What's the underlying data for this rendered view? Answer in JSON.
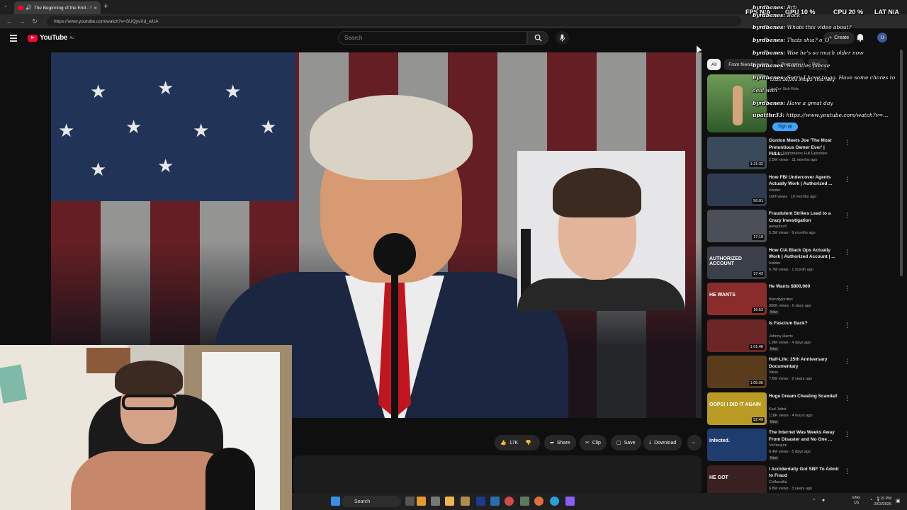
{
  "browser": {
    "tab_title": "The Beginning of the End - Yo",
    "url": "https://www.youtube.com/watch?v=SUQyvXd_wUA"
  },
  "youtube": {
    "logo_text": "YouTube",
    "logo_region": "AU",
    "search_placeholder": "Search",
    "create_label": "Create",
    "avatar_letter": "U"
  },
  "actions": {
    "likes": "17K",
    "share": "Share",
    "clip": "Clip",
    "save": "Save",
    "download": "Download"
  },
  "chips": [
    "All",
    "From friendlyjordies",
    "Podcasts",
    "Poli..."
  ],
  "ad": {
    "title": "Walk 10,000 Steps This May",
    "sub": "Up For Sick Kids",
    "cta": "Sign up"
  },
  "recommendations": [
    {
      "title": "Gordon Meets Joe 'The Most Pretentious Owner Ever' | FULL...",
      "channel": "Kitchen Nightmares Full Episodes",
      "meta": "2.5M views · 11 months ago",
      "duration": "1:21:32",
      "new": "",
      "color": "#3b4a5a"
    },
    {
      "title": "How FBI Undercover Agents Actually Work | Authorized ...",
      "channel": "Insider",
      "meta": "16M views · 10 months ago",
      "duration": "56:01",
      "new": "",
      "color": "#2e3b50"
    },
    {
      "title": "Fraudulent Strikes Lead to a Crazy Investigation",
      "channel": "penguinz0",
      "meta": "5.3M views · 9 months ago",
      "duration": "17:19",
      "new": "",
      "color": "#4b4f57"
    },
    {
      "title": "How CIA Black Ops Actually Work | Authorized Account | ...",
      "channel": "Insider",
      "meta": "6.7M views · 1 month ago",
      "duration": "37:42",
      "new": "",
      "color": "#3a3f4a"
    },
    {
      "title": "He Wants $800,000",
      "channel": "friendlyjordies",
      "meta": "306K views · 6 days ago",
      "duration": "16:52",
      "new": "New",
      "color": "#8a2c2c"
    },
    {
      "title": "Is Fascism Back?",
      "channel": "Johnny Harris",
      "meta": "1.8M views · 4 days ago",
      "duration": "1:01:48",
      "new": "New",
      "color": "#6d2626"
    },
    {
      "title": "Half-Life: 25th Anniversary Documentary",
      "channel": "Valve",
      "meta": "7.6M views · 2 years ago",
      "duration": "1:05:06",
      "new": "",
      "color": "#5a3b1c"
    },
    {
      "title": "Huge Dream Cheating Scandal!",
      "channel": "Karl Jobst",
      "meta": "118K views · 4 hours ago",
      "duration": "52:49",
      "new": "New",
      "color": "#b89a24"
    },
    {
      "title": "The Internet Was Weeks Away From Disaster and No One ...",
      "channel": "Veritasium",
      "meta": "8.4M views · 5 days ago",
      "duration": "",
      "new": "New",
      "color": "#1f3c6e"
    },
    {
      "title": "I Accidentally Got SBF To Admit to Fraud",
      "channel": "Coffeezilla",
      "meta": "6.8M views · 3 years ago",
      "duration": "",
      "new": "",
      "color": "#3a2020"
    }
  ],
  "thumb_texts": [
    "",
    "",
    "",
    "AUTHORIZED ACCOUNT",
    "HE WANTS",
    "",
    "",
    "OOPS! I DID IT AGAIN",
    "Infected.",
    "HE GOT"
  ],
  "stats": {
    "fps": "FPS N/A",
    "gpu": "GPU 10 %",
    "cpu": "CPU 20 %",
    "lat": "LAT N/A"
  },
  "chat": [
    {
      "user": "byrdbanes:",
      "msg": "Brb"
    },
    {
      "user": "byrdbanes:",
      "msg": "Back"
    },
    {
      "user": "byrdbanes:",
      "msg": "Whats this video about?"
    },
    {
      "user": "byrdbanes:",
      "msg": "Thats shia? o_O"
    },
    {
      "user": "byrdbanes:",
      "msg": "Woe he's so much older now"
    },
    {
      "user": "byrdbanes:",
      "msg": "Subtitles please"
    },
    {
      "user": "byrdbanes:",
      "msg": "Sorry I have to go. Have some chores to deal with"
    },
    {
      "user": "byrdbanes:",
      "msg": "Have a great day"
    },
    {
      "user": "upatthr33:",
      "msg": "https://www.youtube.com/watch?v=..."
    }
  ],
  "taskbar": {
    "search": "Search",
    "lang_top": "ENG",
    "lang_bottom": "US",
    "time": "5:15 PM",
    "date": "3/03/2026"
  }
}
